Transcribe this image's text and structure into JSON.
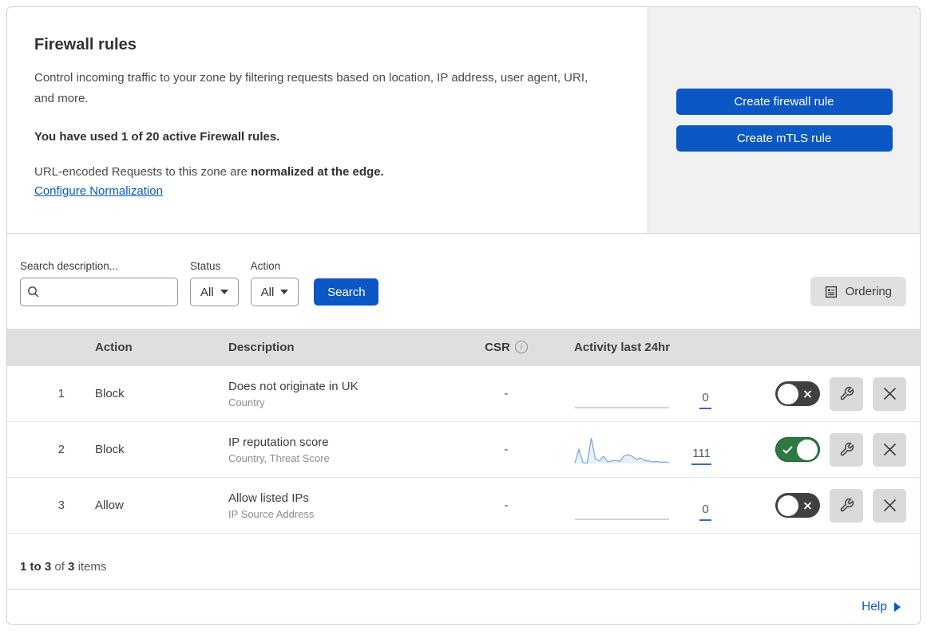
{
  "header": {
    "title": "Firewall rules",
    "description": "Control incoming traffic to your zone by filtering requests based on location, IP address, user agent, URI, and more.",
    "usage": "You have used 1 of 20 active Firewall rules.",
    "normalization_text": "URL-encoded Requests to this zone are ",
    "normalization_bold": "normalized at the edge.",
    "normalization_link": "Configure Normalization",
    "create_firewall_label": "Create firewall rule",
    "create_mtls_label": "Create mTLS rule"
  },
  "filters": {
    "search_label": "Search description...",
    "search_value": "",
    "status_label": "Status",
    "status_value": "All",
    "action_label": "Action",
    "action_value": "All",
    "search_button_label": "Search",
    "ordering_label": "Ordering"
  },
  "table": {
    "headers": {
      "action": "Action",
      "description": "Description",
      "csr": "CSR",
      "activity": "Activity last 24hr"
    },
    "rows": [
      {
        "num": "1",
        "action": "Block",
        "description": "Does not originate in UK",
        "fields": "Country",
        "csr": "-",
        "count": "0",
        "enabled": false,
        "sparkline": [
          0,
          0,
          0,
          0,
          0,
          0,
          0,
          0,
          0,
          0,
          0,
          0,
          0,
          0,
          0,
          0,
          0,
          0,
          0,
          0,
          0,
          0,
          0,
          0
        ],
        "spark_color": "#b4b9bf",
        "spark_fill": "transparent"
      },
      {
        "num": "2",
        "action": "Block",
        "description": "IP reputation score",
        "fields": "Country, Threat Score",
        "csr": "-",
        "count": "111",
        "enabled": true,
        "sparkline": [
          2,
          55,
          3,
          2,
          100,
          18,
          10,
          28,
          6,
          10,
          12,
          8,
          30,
          35,
          28,
          15,
          22,
          12,
          10,
          6,
          8,
          5,
          6,
          4
        ],
        "spark_color": "#7da7e8",
        "spark_fill": "#e9effb"
      },
      {
        "num": "3",
        "action": "Allow",
        "description": "Allow listed IPs",
        "fields": "IP Source Address",
        "csr": "-",
        "count": "0",
        "enabled": false,
        "sparkline": [
          0,
          0,
          0,
          0,
          0,
          0,
          0,
          0,
          0,
          0,
          0,
          0,
          0,
          0,
          0,
          0,
          0,
          0,
          0,
          0,
          0,
          0,
          0,
          0
        ],
        "spark_color": "#b4b9bf",
        "spark_fill": "transparent"
      }
    ]
  },
  "footer": {
    "range": "1 to 3",
    "of": "of",
    "total": "3",
    "items": "items",
    "help_label": "Help"
  },
  "icons": {
    "info_glyph": "i"
  },
  "colors": {
    "accent": "#0b57c4",
    "panel_bg": "#f1f1f1",
    "table_header_bg": "#dfdfdf",
    "button_gray": "#e0e0e0",
    "icon_btn_bg": "#d9d9d9",
    "toggle_on": "#2c7a3f",
    "toggle_off": "#404040",
    "border": "#d0d0d0",
    "row_border": "#e4e4e4"
  }
}
